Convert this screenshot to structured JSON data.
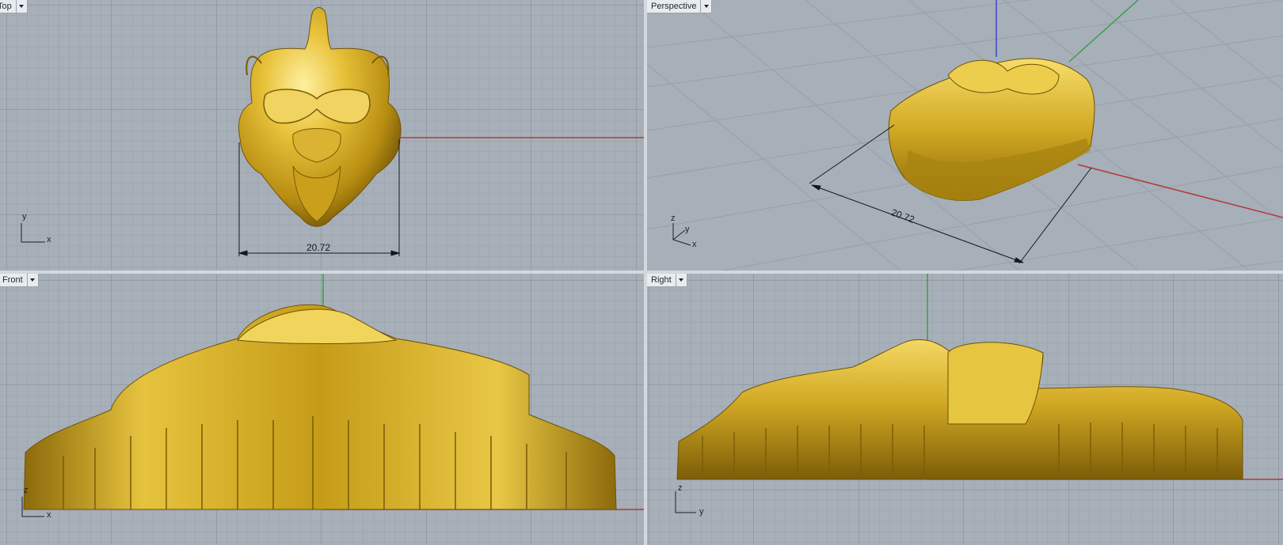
{
  "viewports": {
    "top": {
      "label": "Top",
      "dimension": "20.72",
      "axis_x": "x",
      "axis_y": "y"
    },
    "perspective": {
      "label": "Perspective",
      "dimension": "20.72",
      "axis_x": "x",
      "axis_y": "y",
      "axis_z": "z"
    },
    "front": {
      "label": "Front",
      "axis_x": "x",
      "axis_z": "z"
    },
    "right": {
      "label": "Right",
      "axis_y": "y",
      "axis_z": "z"
    }
  },
  "colors": {
    "viewport_bg": "#a7afb8",
    "grid_minor": "#97a0aa",
    "grid_major": "#7f8893",
    "x_axis": "#b33a3a",
    "y_axis": "#36a046",
    "z_axis": "#3c46c8",
    "model_gold": "#c9a21b"
  },
  "icons": [
    "viewport-dropdown-icon",
    "cplane-axis-icon"
  ]
}
